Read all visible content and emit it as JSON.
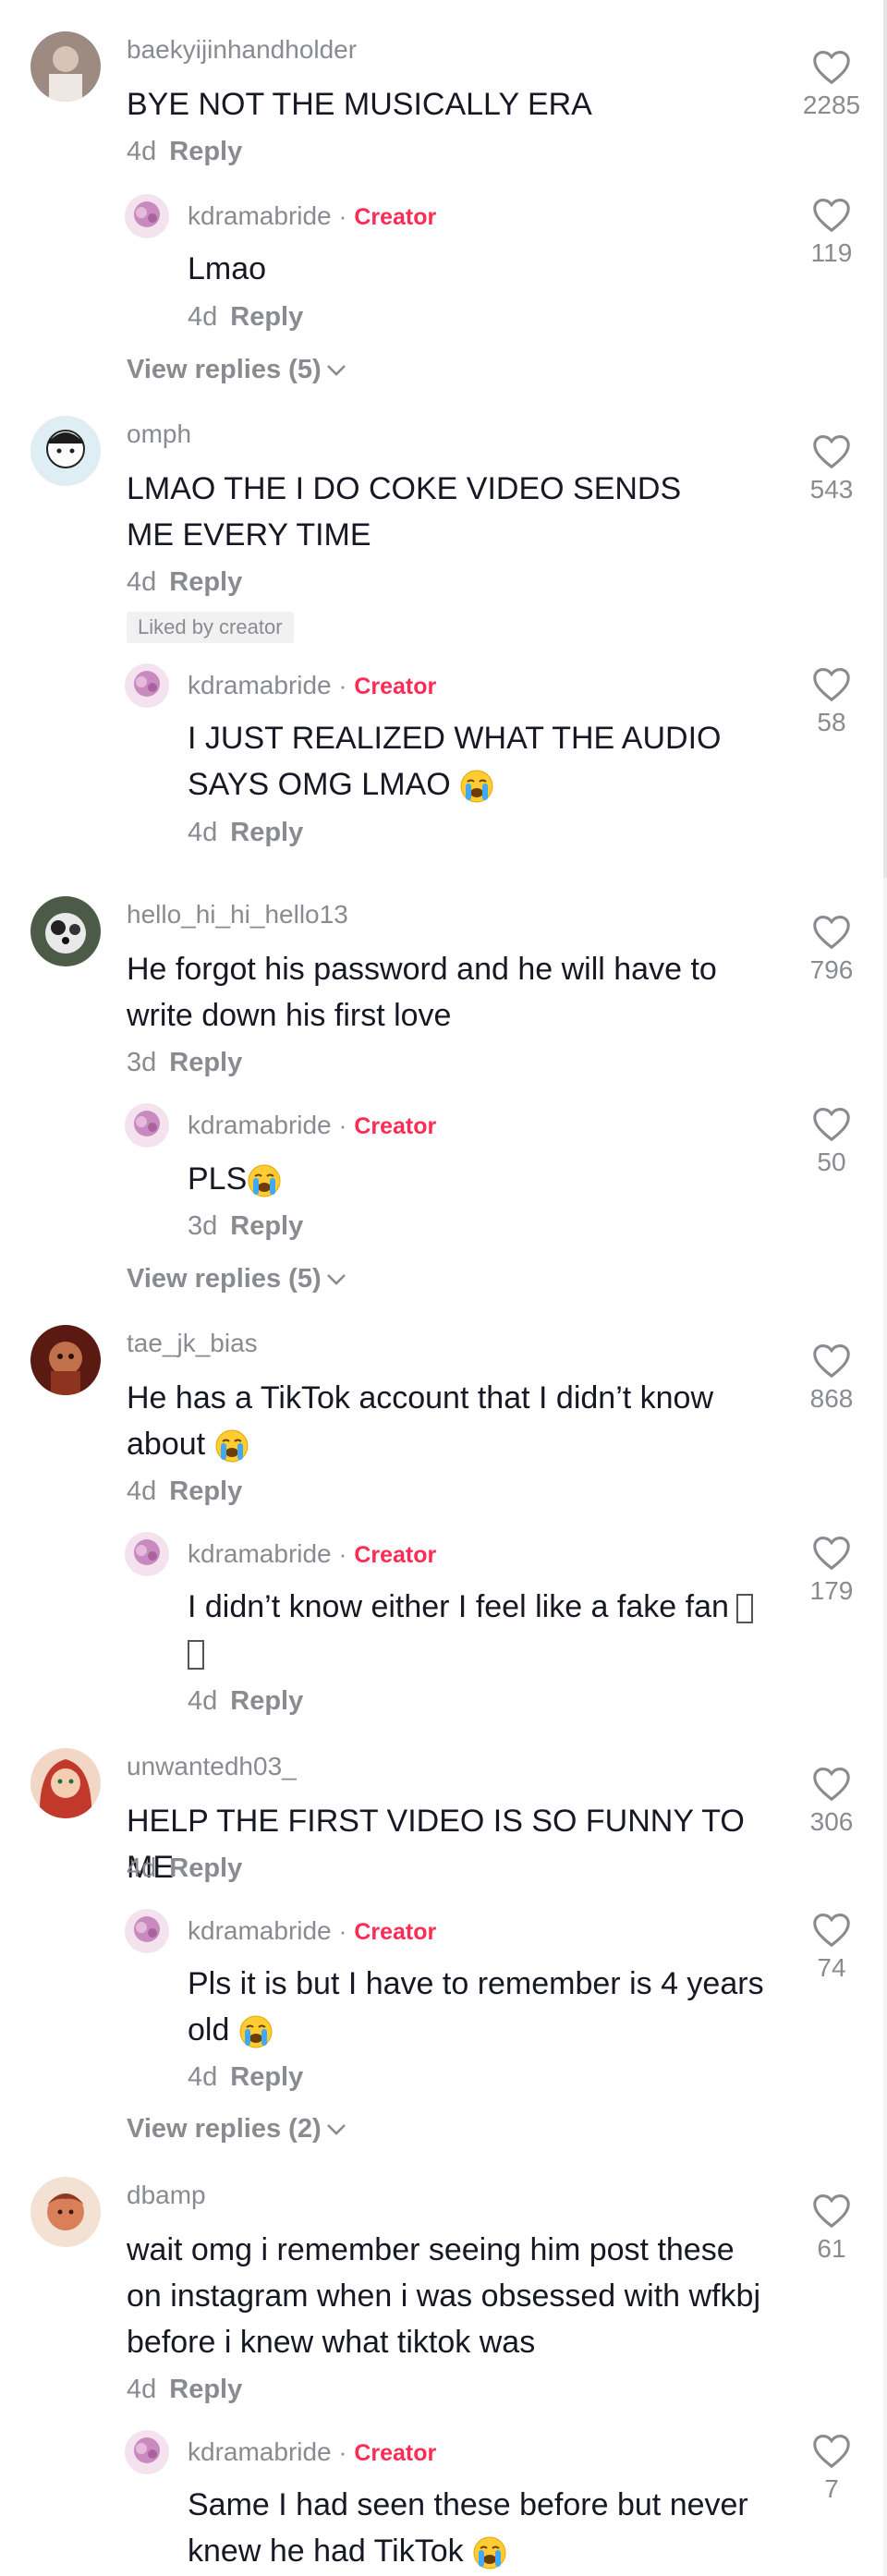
{
  "reply_label": "Reply",
  "creator_label": "Creator",
  "liked_by_creator_label": "Liked by creator",
  "icons": {
    "like": "heart-outline-icon",
    "expand": "chevron-down-icon",
    "emoji": "loudly-crying-face-icon"
  },
  "colors": {
    "creator": "#fe2c55",
    "secondary": "#8a8b91",
    "text": "#161823"
  },
  "threads": [
    {
      "comment": {
        "username": "baekyijinhandholder",
        "text": "BYE NOT THE MUSICALLY ERA",
        "time": "4d",
        "likes": "2285"
      },
      "reply": {
        "username": "kdramabride",
        "text": "Lmao",
        "time": "4d",
        "likes": "119"
      },
      "view_replies": "View replies (5)"
    },
    {
      "comment": {
        "username": "omph",
        "text": "LMAO THE I DO COKE VIDEO SENDS ME EVERY TIME",
        "time": "4d",
        "likes": "543"
      },
      "reply": {
        "username": "kdramabride",
        "text": "I JUST REALIZED WHAT THE AUDIO SAYS OMG LMAO",
        "time": "4d",
        "likes": "58"
      }
    },
    {
      "comment": {
        "username": "hello_hi_hi_hello13",
        "text": "He forgot his password and he will have to write down his first love",
        "time": "3d",
        "likes": "796"
      },
      "reply": {
        "username": "kdramabride",
        "text": "PLS",
        "time": "3d",
        "likes": "50"
      },
      "view_replies": "View replies (5)"
    },
    {
      "comment": {
        "username": "tae_jk_bias",
        "text": "He has a TikTok account that I didn’t know about",
        "time": "4d",
        "likes": "868"
      },
      "reply": {
        "username": "kdramabride",
        "text": "I didn’t know either I feel like a fake fan",
        "time": "4d",
        "likes": "179"
      }
    },
    {
      "comment": {
        "username": "unwantedh03_",
        "text": "HELP THE FIRST VIDEO IS SO FUNNY TO ME",
        "time": "4d",
        "likes": "306"
      },
      "reply": {
        "username": "kdramabride",
        "text": "Pls it is but I have to remember is 4 years old",
        "time": "4d",
        "likes": "74"
      },
      "view_replies": "View replies (2)"
    },
    {
      "comment": {
        "username": "dbamp",
        "text": "wait omg i remember seeing him post these on instagram when i was obsessed with wfkbj before i knew what tiktok was",
        "time": "4d",
        "likes": "61"
      },
      "reply": {
        "username": "kdramabride",
        "text": "Same I had seen these before but never knew he had TikTok",
        "likes": "7"
      }
    }
  ]
}
